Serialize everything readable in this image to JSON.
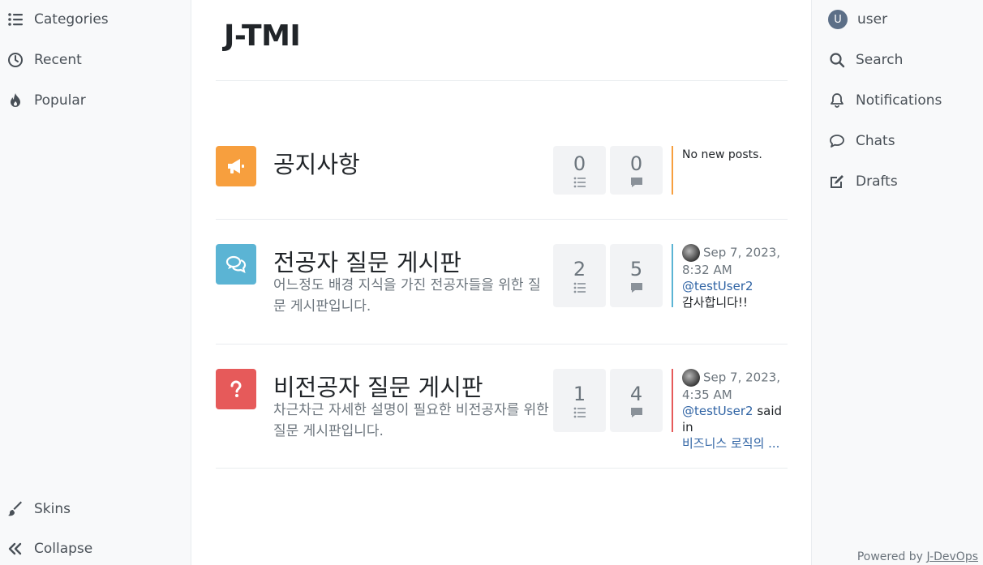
{
  "left_nav": {
    "items": [
      {
        "label": "Categories",
        "icon": "list-icon"
      },
      {
        "label": "Recent",
        "icon": "clock-icon"
      },
      {
        "label": "Popular",
        "icon": "fire-icon"
      }
    ],
    "bottom": [
      {
        "label": "Skins",
        "icon": "brush-icon"
      },
      {
        "label": "Collapse",
        "icon": "double-chevron-left-icon"
      }
    ]
  },
  "right_nav": {
    "user": {
      "avatar_letter": "U",
      "label": "user"
    },
    "items": [
      {
        "label": "Search",
        "icon": "search-icon"
      },
      {
        "label": "Notifications",
        "icon": "bell-icon"
      },
      {
        "label": "Chats",
        "icon": "chat-bubble-icon"
      },
      {
        "label": "Drafts",
        "icon": "edit-icon"
      }
    ]
  },
  "header": {
    "title": "J-TMI"
  },
  "categories": [
    {
      "name": "공지사항",
      "description": "",
      "icon": "megaphone-icon",
      "color": "#f79f3e",
      "topics": "0",
      "posts": "0",
      "teaser": {
        "no_posts": "No new posts."
      }
    },
    {
      "name": "전공자 질문 게시판",
      "description": "어느정도 배경 지식을 가진 전공자들을 위한 질문 게시판입니다.",
      "icon": "comments-icon",
      "color": "#5bb4d4",
      "topics": "2",
      "posts": "5",
      "teaser": {
        "time": "Sep 7, 2023, 8:32 AM",
        "user": "@testUser2",
        "text": "감사합니다!!"
      }
    },
    {
      "name": "비전공자 질문 게시판",
      "description": "차근차근 자세한 설명이 필요한 비전공자를 위한 질문 게시판입니다.",
      "icon": "question-icon",
      "color": "#e65a5a",
      "topics": "1",
      "posts": "4",
      "teaser": {
        "time": "Sep 7, 2023, 4:35 AM",
        "user": "@testUser2",
        "said_in": "said in",
        "topic": "비즈니스 로직의 ..."
      }
    }
  ],
  "footer": {
    "prefix": "Powered by",
    "link": "J-DevOps"
  }
}
